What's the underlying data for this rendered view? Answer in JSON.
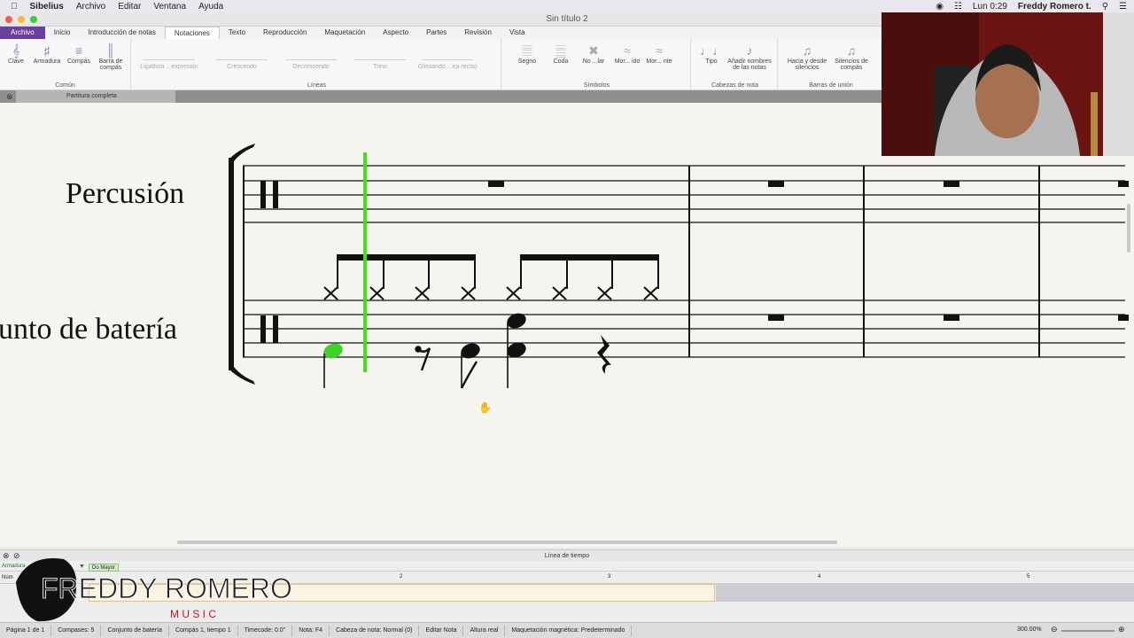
{
  "menubar": {
    "app": "Sibelius",
    "items": [
      "Archivo",
      "Editar",
      "Ventana",
      "Ayuda"
    ],
    "clock": "Lun 0:29",
    "user": "Freddy  Romero t."
  },
  "window": {
    "title": "Sin título 2"
  },
  "ribbon": {
    "tabs": [
      "Archivo",
      "Inicio",
      "Introducción de notas",
      "Notaciones",
      "Texto",
      "Reproducción",
      "Maquetación",
      "Aspecto",
      "Partes",
      "Revisión",
      "Vista"
    ],
    "active_tab": "Notaciones",
    "comun": {
      "label": "Común",
      "buttons": [
        "Clave",
        "Armadura",
        "Compás",
        "Barra de compás"
      ]
    },
    "lineas": {
      "label": "Líneas",
      "items": [
        "Ligadura ...expresión",
        "Crescendo",
        "Decrescendo",
        "Trino",
        "Glissando ...ea recta)"
      ]
    },
    "simbolos": {
      "label": "Símbolos",
      "items": [
        "Segno",
        "Coda",
        "No ...lar",
        "Mor... ido",
        "Mor... nte"
      ]
    },
    "cabezas": {
      "label": "Cabezas de nota",
      "buttons": [
        "Tipo",
        "Añadir nombres de las notas"
      ]
    },
    "barras": {
      "label": "Barras de unión",
      "buttons": [
        "Hacia y desde silencios",
        "Silencios de compás"
      ]
    }
  },
  "partbar": {
    "tab": "Partitura completa"
  },
  "score": {
    "staff1_name": "Percusión",
    "staff2_name": "unto de batería"
  },
  "timeline": {
    "title": "Línea de tiempo",
    "key_label": "Armadura",
    "key_value": "Do Mayor",
    "row_label": "Núm",
    "bar_numbers": [
      "2",
      "3",
      "4",
      "5"
    ]
  },
  "logo": {
    "line1": "FREDDY ROMERO",
    "line2": "M U S I C"
  },
  "status": {
    "page": "Página 1 de 1",
    "bars": "Compases: 5",
    "instrument": "Conjunto de batería",
    "position": "Compás 1, tiempo 1",
    "timecode": "Timecode: 0.0\"",
    "note": "Nota: F4",
    "notehead": "Cabeza de nota: Normal (0)",
    "mode": "Editar Nota",
    "pitch": "Altura real",
    "magnetic": "Maquetación magnética: Predeterminado",
    "zoom": "300.00%"
  },
  "colors": {
    "accent": "#6b3fa0",
    "selection": "#3fd12b",
    "playline": "#44e01c"
  }
}
